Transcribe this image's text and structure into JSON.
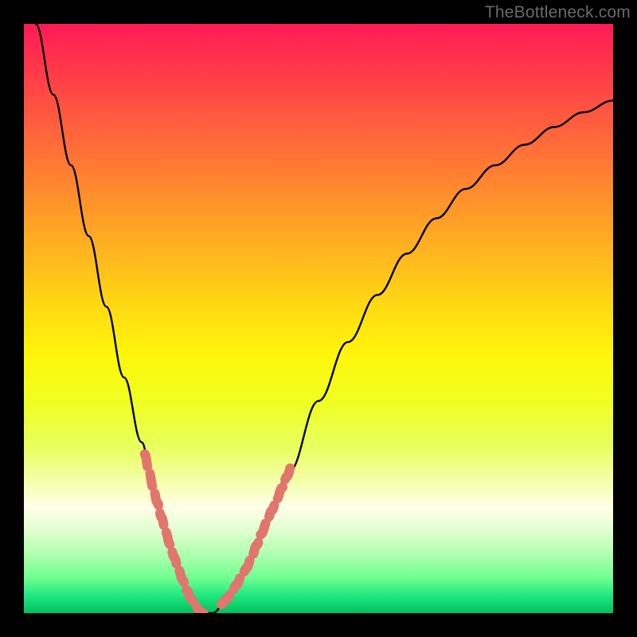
{
  "watermark": "TheBottleneck.com",
  "chart_data": {
    "type": "line",
    "title": "",
    "xlabel": "",
    "ylabel": "",
    "xlim": [
      0,
      100
    ],
    "ylim": [
      0,
      100
    ],
    "series": [
      {
        "name": "bottleneck-curve",
        "x": [
          2,
          5,
          8,
          11,
          14,
          17,
          20,
          22,
          24,
          26,
          28,
          30,
          32,
          35,
          38,
          41,
          45,
          50,
          55,
          60,
          65,
          70,
          75,
          80,
          85,
          90,
          95,
          100
        ],
        "y": [
          100,
          88,
          76,
          64,
          52,
          40,
          29,
          21,
          14,
          8,
          3,
          0,
          0,
          3,
          8,
          15,
          24,
          36,
          46,
          54,
          61,
          67,
          72,
          76,
          79.5,
          82.5,
          85,
          87
        ]
      }
    ],
    "highlight_segments": [
      {
        "name": "left-highlight",
        "x_range": [
          20.5,
          30.5
        ]
      },
      {
        "name": "right-highlight",
        "x_range": [
          33.5,
          45.5
        ]
      }
    ],
    "gradient_stops": [
      {
        "pos": 0,
        "color": "#ff1a55"
      },
      {
        "pos": 50,
        "color": "#fff50a"
      },
      {
        "pos": 100,
        "color": "#00c060"
      }
    ]
  }
}
